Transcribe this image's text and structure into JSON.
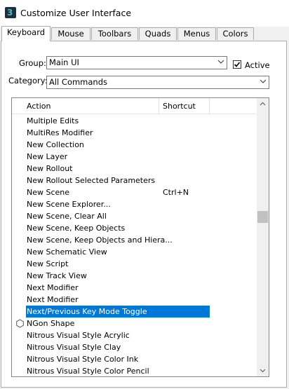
{
  "window": {
    "title": "Customize User Interface",
    "icon": "3ds-max-logo-icon",
    "icon_letter": "3"
  },
  "tabs": [
    {
      "label": "Keyboard",
      "active": true
    },
    {
      "label": "Mouse",
      "active": false
    },
    {
      "label": "Toolbars",
      "active": false
    },
    {
      "label": "Quads",
      "active": false
    },
    {
      "label": "Menus",
      "active": false
    },
    {
      "label": "Colors",
      "active": false
    }
  ],
  "group": {
    "label": "Group:",
    "value": "Main UI"
  },
  "active_toggle": {
    "label": "Active",
    "checked": true
  },
  "category": {
    "label": "Category:",
    "value": "All Commands"
  },
  "table": {
    "columns": [
      "Action",
      "Shortcut"
    ],
    "rows": [
      {
        "action": "Multiple Edits",
        "shortcut": ""
      },
      {
        "action": "MultiRes Modifier",
        "shortcut": ""
      },
      {
        "action": "New Collection",
        "shortcut": ""
      },
      {
        "action": "New Layer",
        "shortcut": ""
      },
      {
        "action": "New Rollout",
        "shortcut": ""
      },
      {
        "action": "New Rollout Selected Parameters",
        "shortcut": ""
      },
      {
        "action": "New Scene",
        "shortcut": "Ctrl+N"
      },
      {
        "action": "New Scene Explorer...",
        "shortcut": ""
      },
      {
        "action": "New Scene, Clear All",
        "shortcut": ""
      },
      {
        "action": "New Scene, Keep Objects",
        "shortcut": ""
      },
      {
        "action": "New Scene, Keep Objects and Hiera...",
        "shortcut": ""
      },
      {
        "action": "New Schematic View",
        "shortcut": ""
      },
      {
        "action": "New Script",
        "shortcut": ""
      },
      {
        "action": "New Track View",
        "shortcut": ""
      },
      {
        "action": "Next Modifier",
        "shortcut": ""
      },
      {
        "action": "Next Modifier",
        "shortcut": ""
      },
      {
        "action": "Next/Previous Key Mode Toggle",
        "shortcut": "",
        "selected": true
      },
      {
        "action": "NGon Shape",
        "shortcut": "",
        "icon": "ngon-shape-icon"
      },
      {
        "action": "Nitrous Visual Style Acrylic",
        "shortcut": ""
      },
      {
        "action": "Nitrous Visual Style Clay",
        "shortcut": ""
      },
      {
        "action": "Nitrous Visual Style Color Ink",
        "shortcut": ""
      },
      {
        "action": "Nitrous Visual Style Color Pencil",
        "shortcut": ""
      }
    ]
  },
  "colors": {
    "selection": "#0078d7"
  }
}
